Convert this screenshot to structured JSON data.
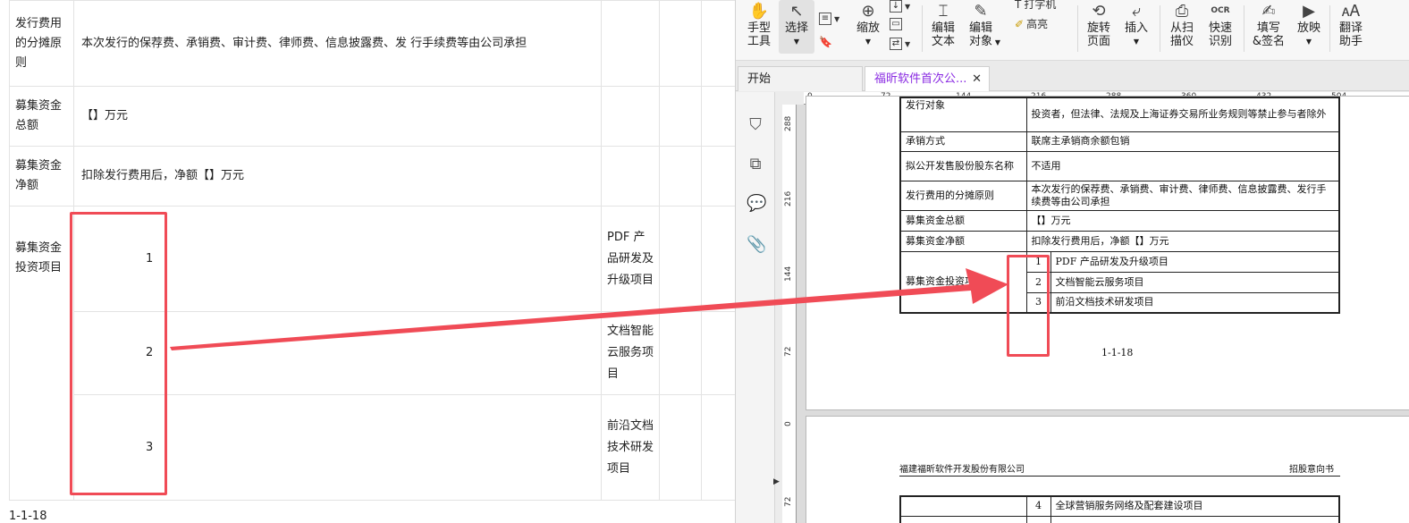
{
  "left_doc": {
    "rows": [
      {
        "label": "发行费用的分摊原则",
        "value": "本次发行的保荐费、承销费、审计费、律师费、信息披露费、发 行手续费等由公司承担"
      },
      {
        "label": "募集资金总额",
        "value": "【】万元"
      },
      {
        "label": "募集资金净额",
        "value": "扣除发行费用后，净额【】万元"
      }
    ],
    "invest": {
      "label": "募集资金投资项目",
      "items": [
        {
          "num": "1",
          "name": "PDF 产品研发及升级项目"
        },
        {
          "num": "2",
          "name": "文档智能云服务项目"
        },
        {
          "num": "3",
          "name": "前沿文档技术研发项目"
        }
      ]
    },
    "page_no": "1-1-18"
  },
  "toolbar": {
    "hand": "手型\n工具",
    "select": "选择",
    "zoom": "缩放",
    "edit_text": "编辑\n文本",
    "edit_object": "编辑\n对象",
    "typewriter": "打字机",
    "highlight": "高亮",
    "rotate": "旋转\n页面",
    "insert": "插入",
    "scan": "从扫\n描仪",
    "ocr": "快速\n识别",
    "fill_sign": "填写\n&签名",
    "play": "放映",
    "translate": "翻译\n助手",
    "ocr_icon_text": "OCR"
  },
  "tabs": [
    {
      "label": "开始"
    },
    {
      "label": "福昕软件首次公..."
    }
  ],
  "ruler": {
    "h_ticks": [
      "0",
      "72",
      "144",
      "216",
      "288",
      "360",
      "432",
      "504"
    ],
    "v_ticks": [
      "288",
      "216",
      "144",
      "72",
      "0",
      "72"
    ]
  },
  "pdf_page1": {
    "rows": [
      {
        "label": "发行对象",
        "value": "投资者，但法律、法规及上海证券交易所业务规则等禁止参与者除外"
      },
      {
        "label": "承销方式",
        "value": "联席主承销商余额包销"
      },
      {
        "label": "拟公开发售股份股东名称",
        "value": "不适用"
      },
      {
        "label": "发行费用的分摊原则",
        "value": "本次发行的保荐费、承销费、审计费、律师费、信息披露费、发行手续费等由公司承担"
      },
      {
        "label": "募集资金总额",
        "value": "【】万元"
      },
      {
        "label": "募集资金净额",
        "value": "扣除发行费用后，净额【】万元"
      }
    ],
    "invest_label": "募集资金投资项目",
    "items": [
      {
        "num": "1",
        "name": "PDF 产品研发及升级项目"
      },
      {
        "num": "2",
        "name": "文档智能云服务项目"
      },
      {
        "num": "3",
        "name": "前沿文档技术研发项目"
      }
    ],
    "page_no": "1-1-18"
  },
  "pdf_page2": {
    "company": "福建福昕软件开发股份有限公司",
    "doc_type": "招股意向书",
    "items": [
      {
        "num": "4",
        "name": "全球营销服务网络及配套建设项目"
      }
    ]
  },
  "colors": {
    "highlight_red": "#f04b56",
    "active_tab": "#8a2be2"
  }
}
